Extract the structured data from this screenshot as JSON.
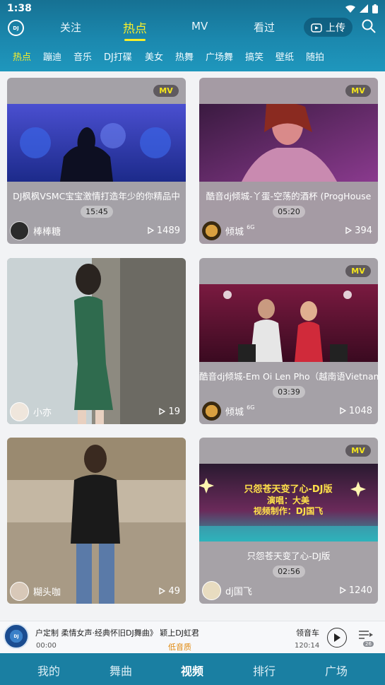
{
  "status_bar": {
    "time": "1:38"
  },
  "top_tabs": [
    {
      "label": "关注"
    },
    {
      "label": "热点",
      "active": true
    },
    {
      "label": "MV"
    },
    {
      "label": "看过"
    }
  ],
  "upload_label": "上传",
  "logo_text": "DJ",
  "categories": [
    "热点",
    "蹦迪",
    "音乐",
    "DJ打碟",
    "美女",
    "热舞",
    "广场舞",
    "搞笑",
    "壁纸",
    "随拍"
  ],
  "cards": [
    {
      "badge": "MV",
      "title": "DJ枫枫VSMC宝宝激情打造年少的你精品中",
      "duration": "15:45",
      "author": "棒棒糖",
      "plays": "1489"
    },
    {
      "badge": "MV",
      "title": "酷音dj倾城-丫蛋-空荡的酒杯 (ProgHouse",
      "duration": "05:20",
      "author": "倾城",
      "author_tag": "6G",
      "plays": "394"
    },
    {
      "author": "小亦",
      "plays": "19"
    },
    {
      "badge": "MV",
      "title": "酷音dj倾城-Em Oi Len Pho（越南语Vietnam",
      "duration": "03:39",
      "author": "倾城",
      "author_tag": "6G",
      "plays": "1048"
    },
    {
      "author": "糊头咖",
      "plays": "49"
    },
    {
      "badge": "MV",
      "title": "只怨苍天变了心-DJ版",
      "duration": "02:56",
      "author": "dj国飞",
      "plays": "1240",
      "thumb_text": [
        "只怨苍天变了心-DJ版",
        "演唱：大美",
        "视频制作：DJ国飞"
      ]
    }
  ],
  "player": {
    "disc_text": "DJ",
    "song": "户定制 柔情女声·经典怀旧DJ舞曲》 颖上DJ虹君",
    "artist": "领音车",
    "time_current": "00:00",
    "quality": "低音质",
    "time_total": "120:14",
    "playlist_count": "26"
  },
  "bottom_nav": [
    {
      "label": "我的"
    },
    {
      "label": "舞曲"
    },
    {
      "label": "视频",
      "active": true
    },
    {
      "label": "排行"
    },
    {
      "label": "广场"
    }
  ],
  "colors": {
    "accent": "#f8ef2a",
    "header": "#1b88ae",
    "nav": "#1a7fa2",
    "card": "#a9a6ab",
    "quality": "#e08a10"
  }
}
